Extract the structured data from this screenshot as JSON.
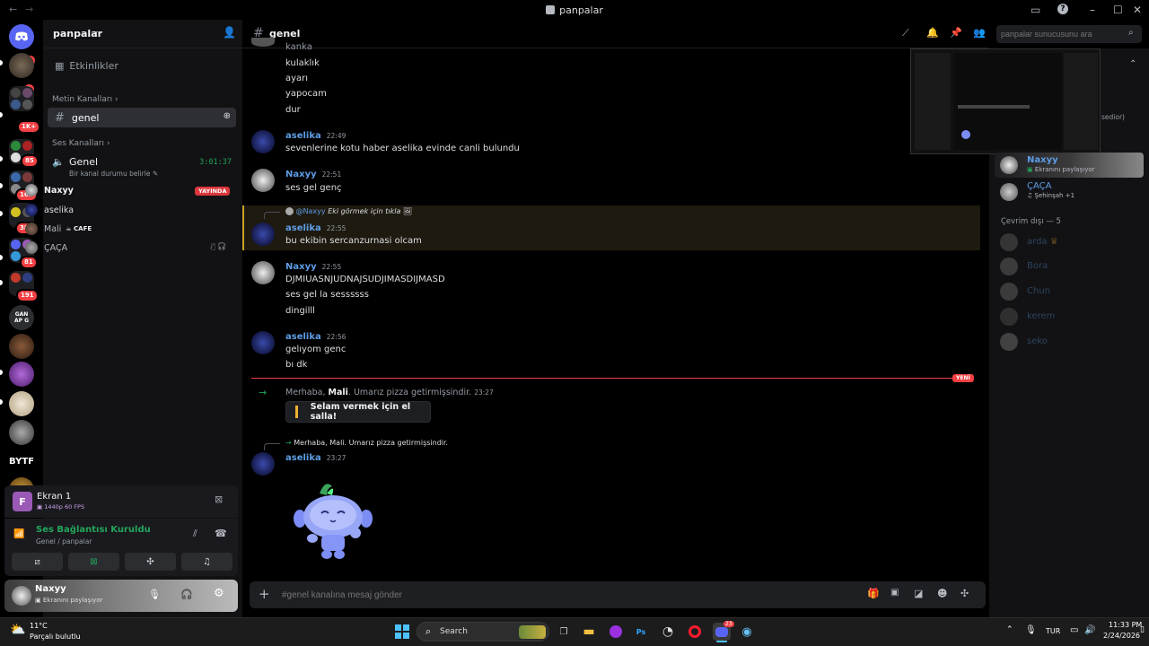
{
  "window": {
    "title": "panpalar"
  },
  "servers": {
    "badges": [
      "13",
      "1",
      "1K+",
      "85",
      "163",
      "388",
      "81",
      "191"
    ],
    "gang_label": "GAN\nAP G",
    "bytf_label": "BYTF"
  },
  "sidebar": {
    "server_name": "panpalar",
    "events": "Etkinlikler",
    "text_category": "Metin Kanalları",
    "text_channel": "genel",
    "voice_category": "Ses Kanalları",
    "voice_channel": "Genel",
    "voice_timer": "3:01:37",
    "voice_status": "Bir kanal durumu belirle",
    "voice_users": [
      {
        "name": "Naxyy",
        "badge": "YAYINDA"
      },
      {
        "name": "aselika",
        "badge": ""
      },
      {
        "name": "Mali",
        "badge": "CAFE"
      },
      {
        "name": "ÇAÇA",
        "badge": ""
      }
    ]
  },
  "stream_panel": {
    "title": "Ekran 1",
    "sub": "1440p 60 FPS",
    "letter": "F"
  },
  "voice_panel": {
    "status": "Ses Bağlantısı Kuruldu",
    "location": "Genel / panpalar"
  },
  "user_panel": {
    "name": "Naxyy",
    "status": "Ekranını paylaşıyor"
  },
  "header": {
    "channel": "genel",
    "search_placeholder": "panpalar sunucusunu ara"
  },
  "messages": {
    "top_lines": [
      "kanka",
      "kulaklık",
      "ayarı",
      "yapocam",
      "dur"
    ],
    "m1": {
      "author": "aselika",
      "time": "22:49",
      "text": "sevenlerine kotu haber aselika evinde canli bulundu"
    },
    "m2": {
      "author": "Naxyy",
      "time": "22:51",
      "text": "ses gel genç"
    },
    "m3": {
      "reply_user": "@Naxyy",
      "reply_text": "Eki görmek için tıkla",
      "author": "aselika",
      "time": "22:55",
      "text": "bu ekibin sercanzurnasi olcam"
    },
    "m4": {
      "author": "Naxyy",
      "time": "22:55",
      "lines": [
        "DJMIUASNJUDNAJSUDJIMASDIJMASD",
        "ses gel la sessssss",
        "dingilll"
      ]
    },
    "m5": {
      "author": "aselika",
      "time": "22:56",
      "lines": [
        "gelıyom genc",
        "bı dk"
      ]
    },
    "new_label": "YENİ",
    "join": {
      "prefix": "Merhaba,",
      "name": "Mali",
      "suffix": ". Umarız pizza getirmişsindir.",
      "time": "23:27",
      "wave_button": "Selam vermek için el salla!"
    },
    "m6": {
      "reply_text": "Merhaba, Mali. Umarız pizza getirmişsindir.",
      "author": "aselika",
      "time": "23:27"
    }
  },
  "composer": {
    "placeholder": "#genel kanalına mesaj gönder"
  },
  "members": {
    "partial_text": "sedior)",
    "online": [
      {
        "name": "Naxyy",
        "status": "Ekranını paylaşıyor"
      },
      {
        "name": "ÇAÇA",
        "status": "Şehinşah",
        "extra": "+1"
      }
    ],
    "offline_header": "Çevrim dışı — 5",
    "offline": [
      "arda",
      "Bora",
      "Chun",
      "kerem",
      "seko"
    ]
  },
  "taskbar": {
    "weather_temp": "11°C",
    "weather_desc": "Parçalı bulutlu",
    "search": "Search",
    "lang": "TUR",
    "time": "11:33 PM",
    "date": "2/24/2026",
    "badge": "23"
  },
  "colors": {
    "accent": "#5865f2",
    "green": "#23a55a",
    "red": "#f23f43",
    "name_blue": "#5e9de6"
  }
}
